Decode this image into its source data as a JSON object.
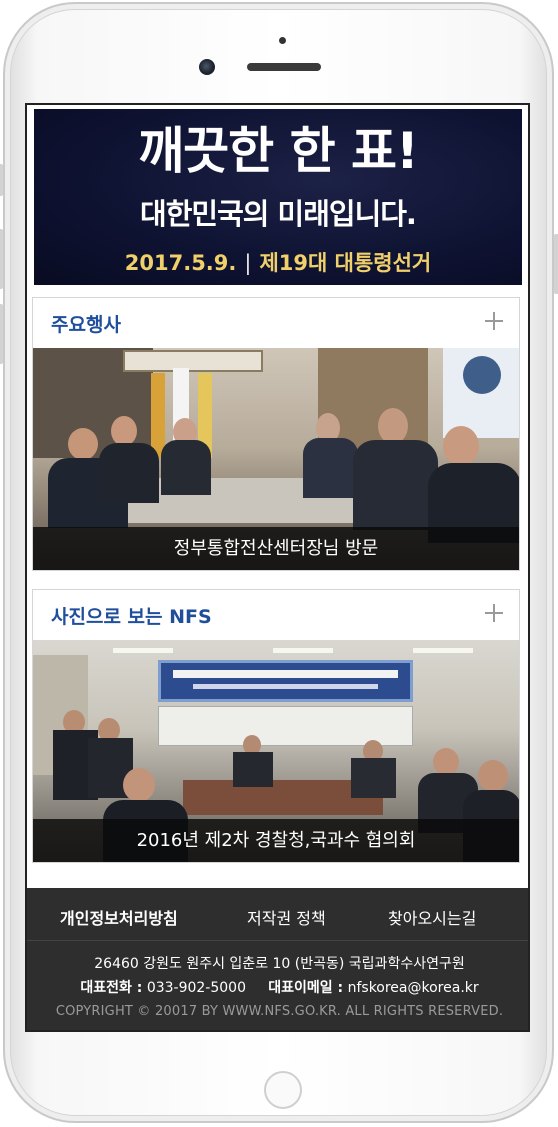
{
  "banner": {
    "title": "깨끗한 한 표!",
    "subtitle": "대한민국의 미래입니다.",
    "date": "2017.5.9.",
    "separator": "|",
    "election": "제19대 대통령선거"
  },
  "sections": [
    {
      "title": "주요행사",
      "caption": "정부통합전산센터장님 방문"
    },
    {
      "title": "사진으로 보는 NFS",
      "caption": "2016년 제2차 경찰청,국과수 협의회"
    }
  ],
  "footer": {
    "links": [
      "개인정보처리방침",
      "저작권 정책",
      "찾아오시는길"
    ],
    "address": "26460 강원도 원주시 입춘로 10 (반곡동) 국립과학수사연구원",
    "phone_label": "대표전화 :",
    "phone": "033-902-5000",
    "email_label": "대표이메일 :",
    "email": "nfskorea@korea.kr",
    "copyright": "COPYRIGHT © 20017 BY WWW.NFS.GO.KR. ALL RIGHTS RESERVED."
  },
  "colors": {
    "section_title": "#1f4f9c",
    "banner_bg": "#0e1231",
    "banner_date": "#f0d06a",
    "footer_bg": "#2e2e2e"
  }
}
